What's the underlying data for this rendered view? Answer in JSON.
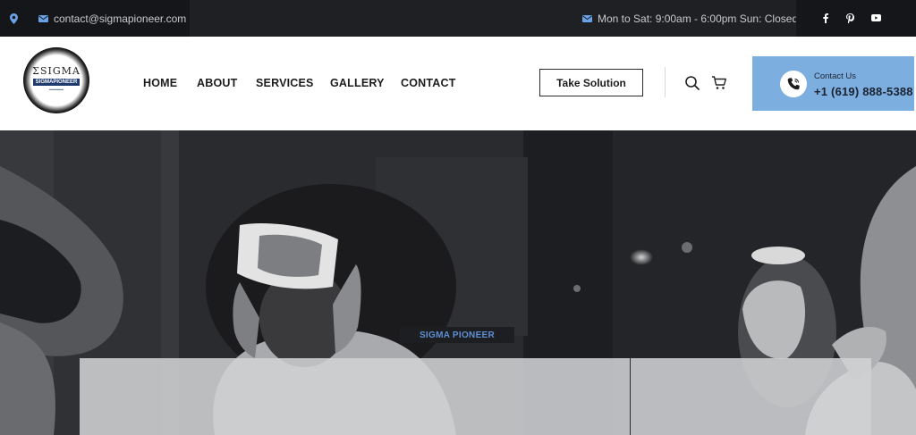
{
  "topbar": {
    "email": "contact@sigmapioneer.com",
    "hours": "Mon to Sat: 9:00am - 6:00pm Sun: Closed",
    "social": [
      {
        "name": "facebook",
        "glyph": "f"
      },
      {
        "name": "pinterest",
        "glyph": "p"
      },
      {
        "name": "youtube",
        "glyph": "▶"
      }
    ]
  },
  "logo": {
    "top_text": "ΣSIGMA",
    "name": "SIGMAPIONEER"
  },
  "nav": {
    "items": [
      "HOME",
      "ABOUT",
      "SERVICES",
      "GALLERY",
      "CONTACT"
    ]
  },
  "header": {
    "cta_label": "Take Solution",
    "contact_label": "Contact Us",
    "contact_phone": "+1 (619) 888-5388"
  },
  "hero": {
    "tag": "SIGMA PIONEER"
  },
  "colors": {
    "topbar_bg": "#1f2024",
    "topbar_dark": "#151619",
    "accent_blue": "#7daee0",
    "icon_blue": "#6aa2e6",
    "hero_bg": "#2b2c30"
  }
}
